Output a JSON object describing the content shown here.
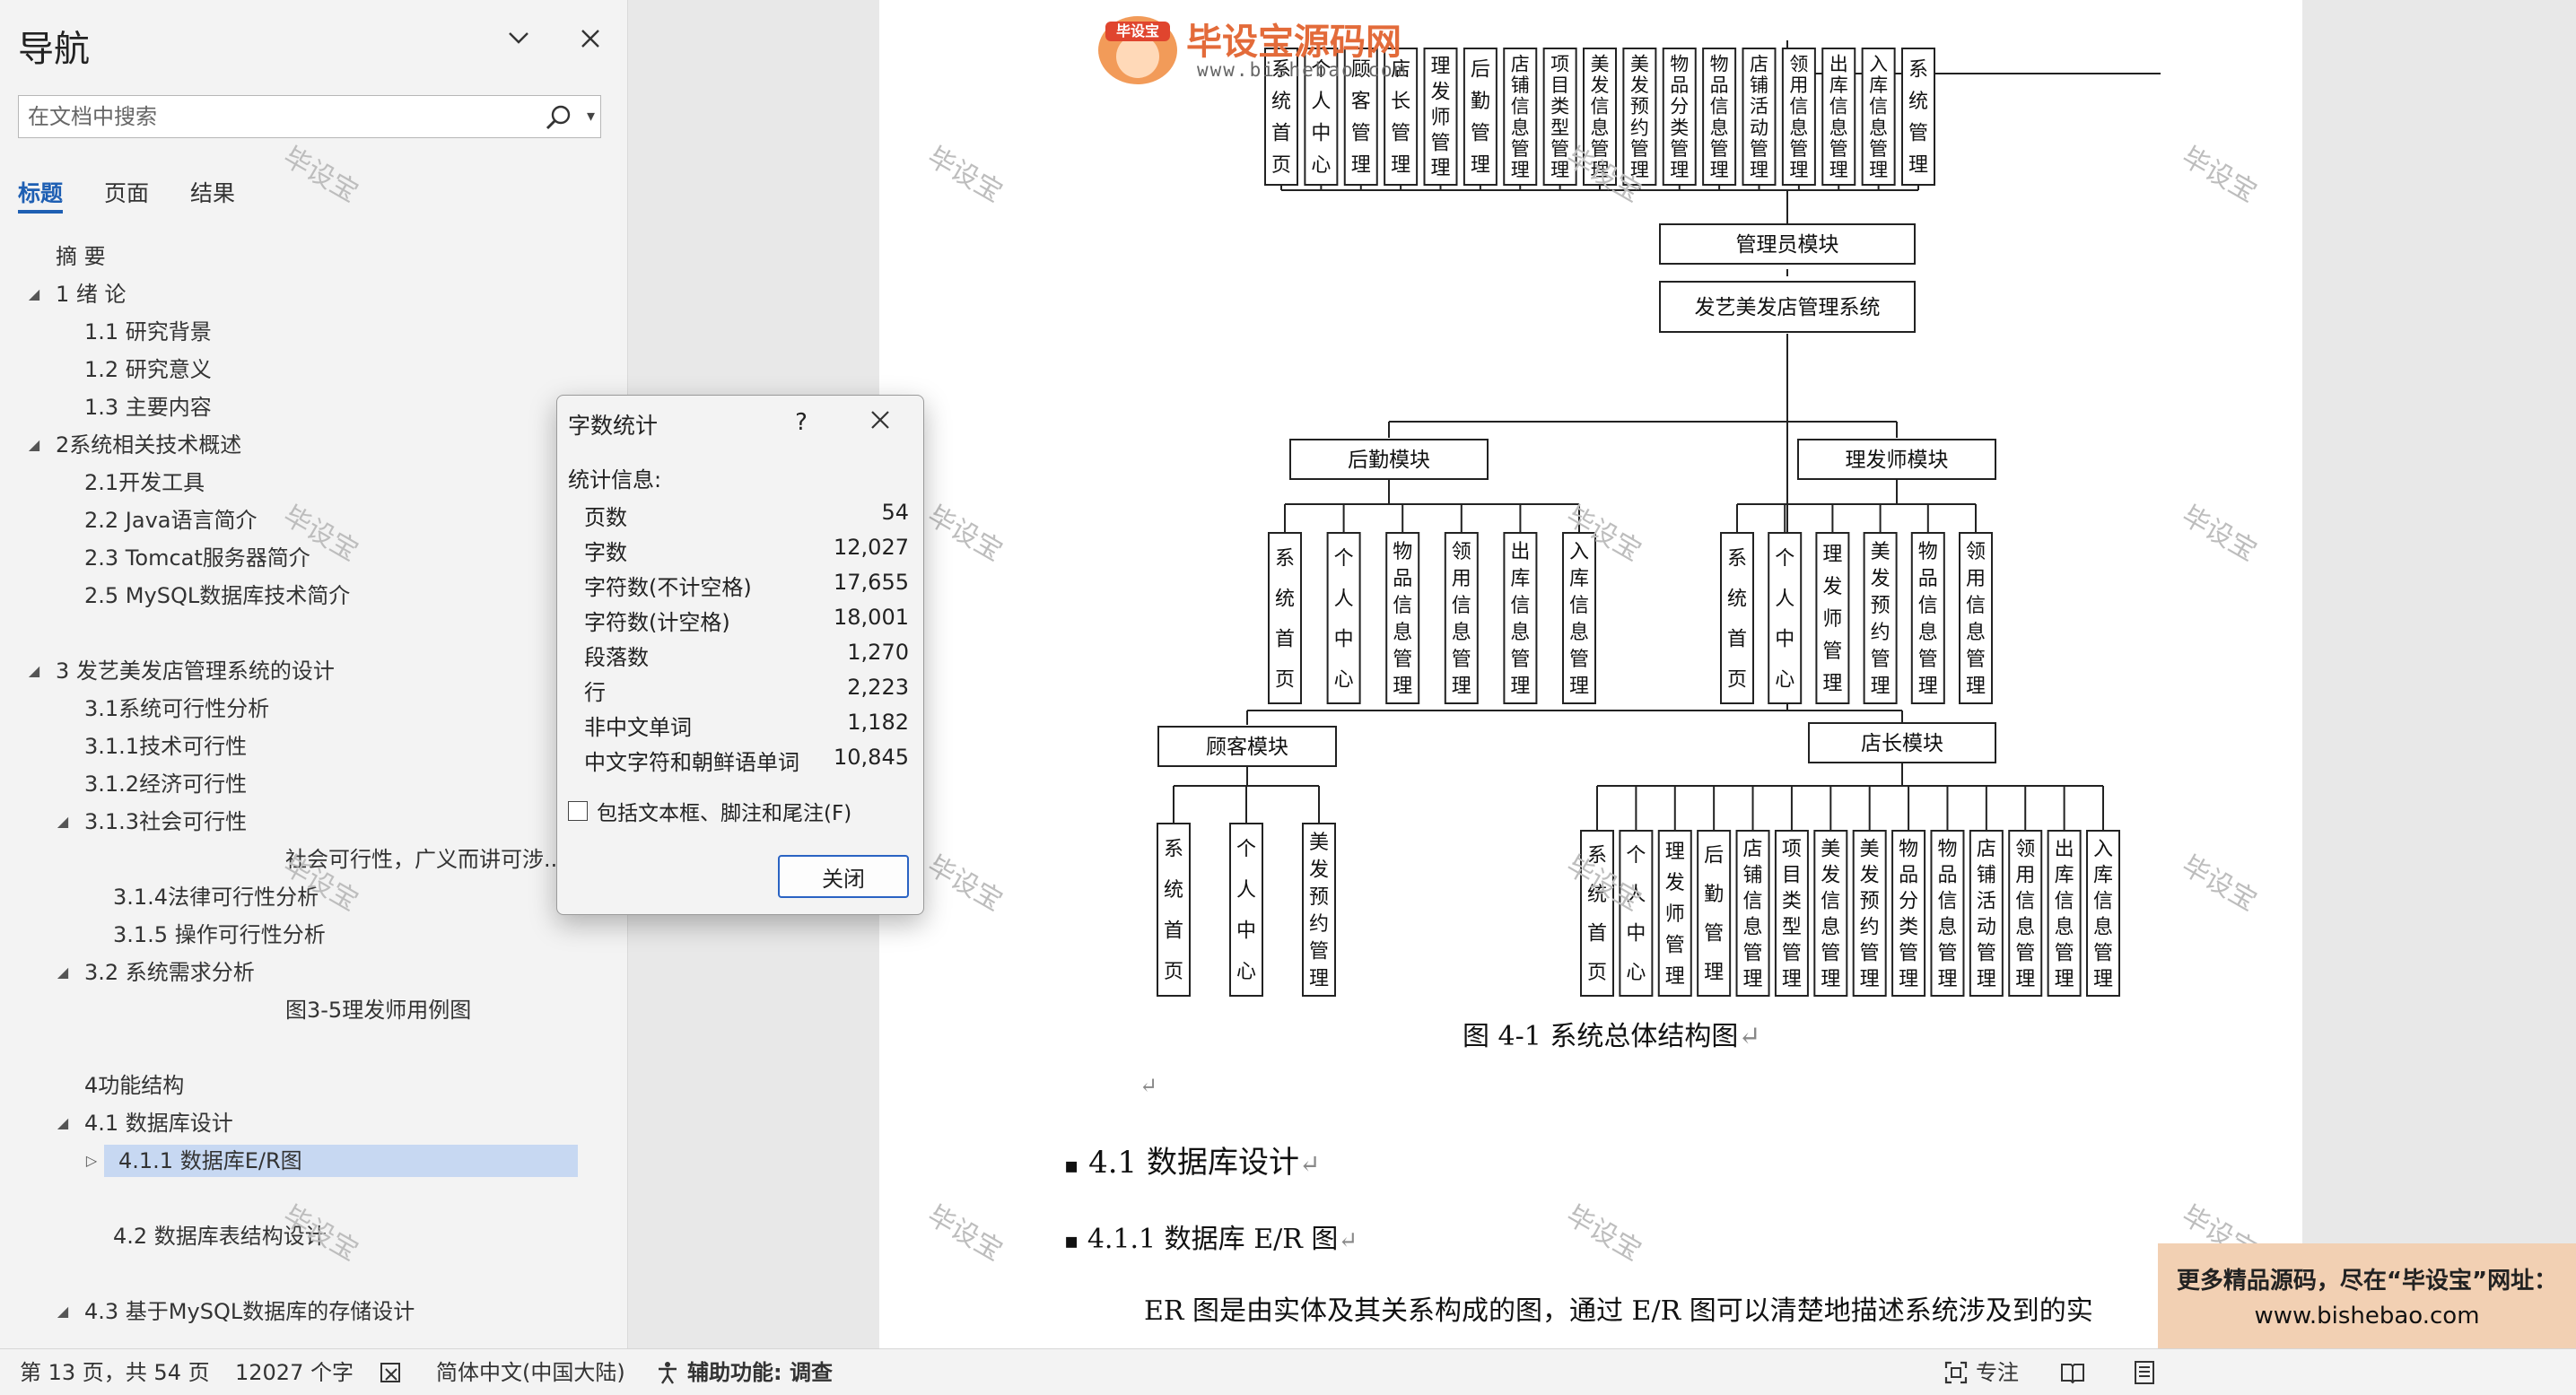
{
  "nav": {
    "title": "导航",
    "search_placeholder": "在文档中搜索",
    "tabs": [
      {
        "label": "标题",
        "active": true
      },
      {
        "label": "页面",
        "active": false
      },
      {
        "label": "结果",
        "active": false
      }
    ],
    "items": [
      {
        "label": "摘  要",
        "level": 1,
        "arrow": ""
      },
      {
        "label": "1 绪  论",
        "level": 1,
        "arrow": "expanded"
      },
      {
        "label": "1.1 研究背景",
        "level": 2,
        "arrow": ""
      },
      {
        "label": "1.2 研究意义",
        "level": 2,
        "arrow": ""
      },
      {
        "label": "1.3 主要内容",
        "level": 2,
        "arrow": ""
      },
      {
        "label": "2系统相关技术概述",
        "level": 1,
        "arrow": "expanded"
      },
      {
        "label": "2.1开发工具",
        "level": 2,
        "arrow": ""
      },
      {
        "label": "2.2 Java语言简介",
        "level": 2,
        "arrow": ""
      },
      {
        "label": "2.3 Tomcat服务器简介",
        "level": 2,
        "arrow": ""
      },
      {
        "label": "2.5 MySQL数据库技术简介",
        "level": 2,
        "arrow": ""
      },
      {
        "label": "3 发艺美发店管理系统的设计",
        "level": 1,
        "arrow": "expanded"
      },
      {
        "label": "3.1系统可行性分析",
        "level": 2,
        "arrow": ""
      },
      {
        "label": "3.1.1技术可行性",
        "level": 2,
        "arrow": ""
      },
      {
        "label": "3.1.2经济可行性",
        "level": 2,
        "arrow": ""
      },
      {
        "label": "3.1.3社会可行性",
        "level": 2,
        "arrow": "expanded"
      },
      {
        "label": "社会可行性，广义而讲可涉...",
        "level": 4,
        "arrow": ""
      },
      {
        "label": "3.1.4法律可行性分析",
        "level": 3,
        "arrow": ""
      },
      {
        "label": "3.1.5 操作可行性分析",
        "level": 3,
        "arrow": ""
      },
      {
        "label": "3.2 系统需求分析",
        "level": 2,
        "arrow": "expanded"
      },
      {
        "label": "图3-5理发师用例图",
        "level": 4,
        "arrow": ""
      },
      {
        "label": "4功能结构",
        "level": 2,
        "arrow": ""
      },
      {
        "label": "4.1 数据库设计",
        "level": 2,
        "arrow": "expanded"
      },
      {
        "label": "4.1.1 数据库E/R图",
        "level": 3,
        "arrow": "collapsed",
        "selected": true
      },
      {
        "label": "4.2 数据库表结构设计",
        "level": 3,
        "arrow": ""
      },
      {
        "label": "4.3 基于MySQL数据库的存储设计",
        "level": 2,
        "arrow": "expanded"
      }
    ]
  },
  "dialog": {
    "title": "字数统计",
    "help": "?",
    "section": "统计信息:",
    "stats": [
      {
        "label": "页数",
        "value": "54"
      },
      {
        "label": "字数",
        "value": "12,027"
      },
      {
        "label": "字符数(不计空格)",
        "value": "17,655"
      },
      {
        "label": "字符数(计空格)",
        "value": "18,001"
      },
      {
        "label": "段落数",
        "value": "1,270"
      },
      {
        "label": "行",
        "value": "2,223"
      },
      {
        "label": "非中文单词",
        "value": "1,182"
      },
      {
        "label": "中文字符和朝鲜语单词",
        "value": "10,845"
      }
    ],
    "checkbox_label": "包括文本框、脚注和尾注(F)",
    "close_label": "关闭"
  },
  "diagram": {
    "admin_top_boxes": [
      "系统首页",
      "个人中心",
      "顾客管理",
      "店长管理",
      "理发师管理",
      "后勤管理",
      "店铺信息管理",
      "项目类型管理",
      "美发信息管理",
      "美发预约管理",
      "物品分类管理",
      "物品信息管理",
      "店铺活动管理",
      "领用信息管理",
      "出库信息管理",
      "入库信息管理",
      "系统管理"
    ],
    "admin_module": "管理员模块",
    "root": "发艺美发店管理系统",
    "logistics_module": "后勤模块",
    "logistics_boxes": [
      "系统首页",
      "个人中心",
      "物品信息管理",
      "领用信息管理",
      "出库信息管理",
      "入库信息管理"
    ],
    "barber_module": "理发师模块",
    "barber_boxes": [
      "系统首页",
      "个人中心",
      "理发师管理",
      "美发预约管理",
      "物品信息管理",
      "领用信息管理"
    ],
    "customer_module": "顾客模块",
    "customer_boxes": [
      "系统首页",
      "个人中心",
      "美发预约管理"
    ],
    "manager_module": "店长模块",
    "manager_boxes": [
      "系统首页",
      "个人中心",
      "理发师管理",
      "后勤管理",
      "店铺信息管理",
      "项目类型管理",
      "美发信息管理",
      "美发预约管理",
      "物品分类管理",
      "物品信息管理",
      "店铺活动管理",
      "领用信息管理",
      "出库信息管理",
      "入库信息管理"
    ]
  },
  "document": {
    "figure_caption": "图 4-1  系统总体结构图",
    "heading_1": "4.1  数据库设计",
    "heading_2": "4.1.1  数据库 E/R 图",
    "paragraph": "ER 图是由实体及其关系构成的图，通过 E/R 图可以清楚地描述系统涉及到的实",
    "return_mark": "↵",
    "watermark": "毕设宝",
    "logo_badge": "毕设宝",
    "logo_title": "毕设宝源码网",
    "logo_url": "www.bishebao.com"
  },
  "promo": {
    "line1": "更多精品源码，尽在“毕设宝”网址：",
    "line2": "www.bishebao.com",
    "bg_color": "#f2d0b3"
  },
  "statusbar": {
    "page_info": "第 13 页，共 54 页",
    "word_count": "12027 个字",
    "language": "简体中文(中国大陆)",
    "accessibility": "辅助功能: 调查",
    "focus": "专注"
  },
  "colors": {
    "accent": "#1e5fb3",
    "selection": "#c7d8f2"
  }
}
